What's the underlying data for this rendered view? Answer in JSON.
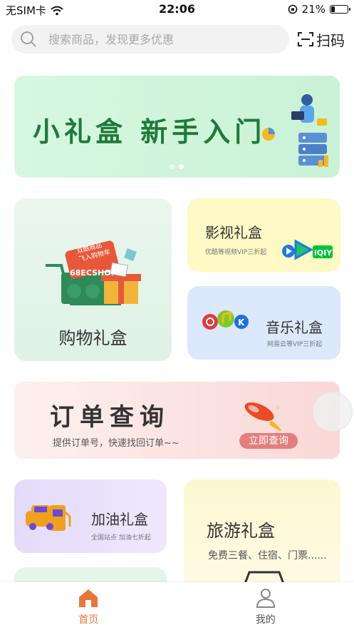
{
  "status_bar": {
    "carrier": "无SIM卡",
    "time": "22:06",
    "battery": "21%",
    "battery_level": 0.21
  },
  "search": {
    "placeholder": "搜索商品，发现更多优惠",
    "scan_label": "扫码"
  },
  "banner": {
    "title": "小礼盒 新手入门",
    "slide_count": 2,
    "active_slide": 2
  },
  "cards": {
    "shopping": {
      "title": "购物礼盒",
      "tag_lines": [
        "双酷商品",
        "飞入购物车"
      ],
      "shop_label": "68ECSHOP"
    },
    "video": {
      "title": "影视礼盒",
      "subtitle": "优酷等视频VIP三折起",
      "brand_text": "iQIY"
    },
    "music": {
      "title": "音乐礼盒",
      "subtitle": "网易云等VIP三折起",
      "brand_letter": "K"
    },
    "order": {
      "title": "订单查询",
      "description": "提供订单号，快速找回订单~~",
      "button": "立即查询"
    },
    "fuel": {
      "title": "加油礼盒",
      "subtitle": "全国站点 加油七折起"
    },
    "travel": {
      "title": "旅游礼盒",
      "subtitle": "免费三餐、住宿、门票......"
    }
  },
  "tab_bar": {
    "home": "首页",
    "mine": "我的"
  },
  "colors": {
    "accent": "#e8763a",
    "banner_text": "#1f7a3a",
    "order_button": "#e37e7e"
  }
}
